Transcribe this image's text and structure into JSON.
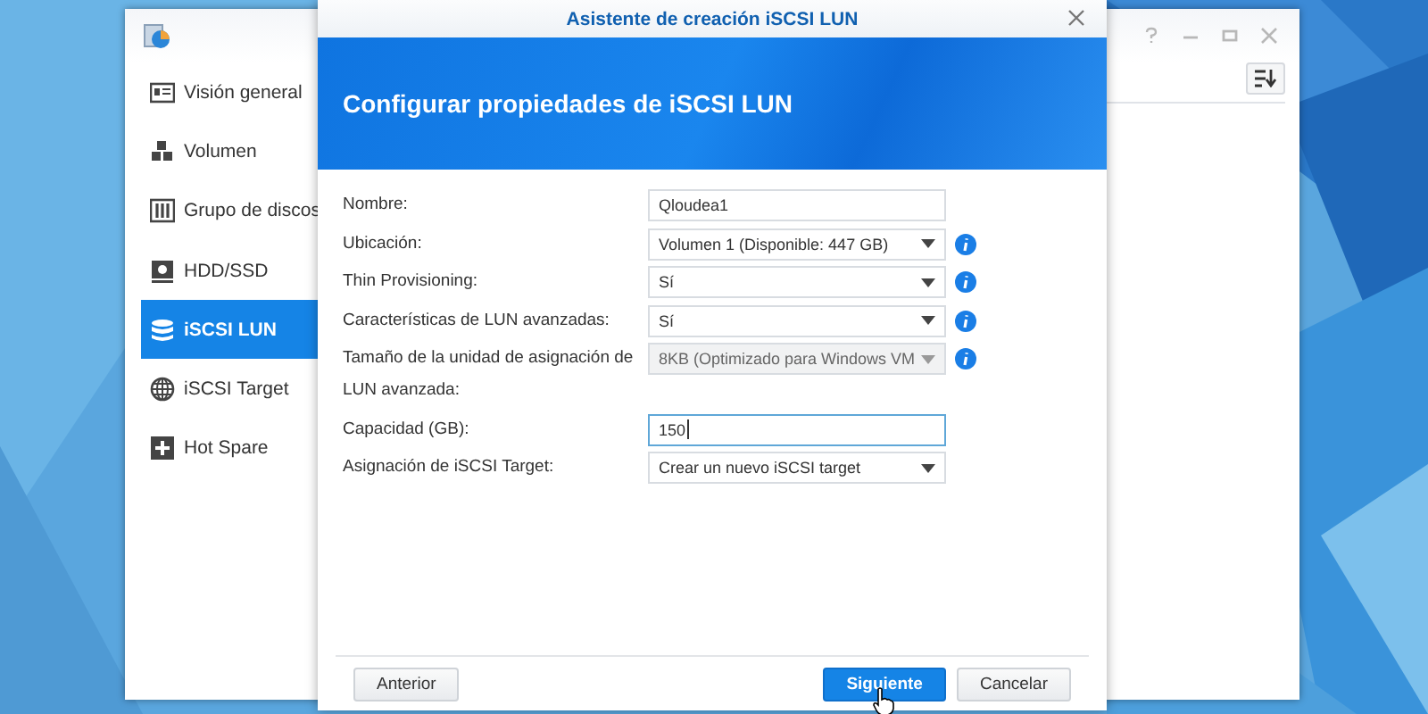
{
  "app_window": {
    "sidebar": [
      {
        "label": "Visión general",
        "selected": false
      },
      {
        "label": "Volumen",
        "selected": false
      },
      {
        "label": "Grupo de discos",
        "selected": false
      },
      {
        "label": "HDD/SSD",
        "selected": false
      },
      {
        "label": "iSCSI LUN",
        "selected": true
      },
      {
        "label": "iSCSI Target",
        "selected": false
      },
      {
        "label": "Hot Spare",
        "selected": false
      }
    ]
  },
  "dialog": {
    "title": "Asistente de creación iSCSI LUN",
    "header": "Configurar propiedades de iSCSI LUN",
    "fields": [
      {
        "label": "Nombre:",
        "kind": "text",
        "value": "Qloudea1",
        "info": false,
        "disabled": false,
        "focused": false
      },
      {
        "label": "Ubicación:",
        "kind": "select",
        "value": "Volumen 1 (Disponible: 447 GB)",
        "info": true,
        "disabled": false,
        "focused": false
      },
      {
        "label": "Thin Provisioning:",
        "kind": "select",
        "value": "Sí",
        "info": true,
        "disabled": false,
        "focused": false
      },
      {
        "label": "Características de LUN avanzadas:",
        "kind": "select",
        "value": "Sí",
        "info": true,
        "disabled": false,
        "focused": false
      },
      {
        "label": "Tamaño de la unidad de asignación de LUN avanzada:",
        "kind": "select",
        "value": "8KB (Optimizado para Windows VM",
        "info": true,
        "disabled": true,
        "focused": false
      },
      {
        "label": "Capacidad (GB):",
        "kind": "text",
        "value": "150",
        "info": false,
        "disabled": false,
        "focused": true
      },
      {
        "label": "Asignación de iSCSI Target:",
        "kind": "select",
        "value": "Crear un nuevo iSCSI target",
        "info": false,
        "disabled": false,
        "focused": false
      }
    ],
    "buttons": [
      {
        "label": "Anterior",
        "kind": "secondary"
      },
      {
        "label": "Siguiente",
        "kind": "primary"
      },
      {
        "label": "Cancelar",
        "kind": "secondary"
      }
    ]
  }
}
